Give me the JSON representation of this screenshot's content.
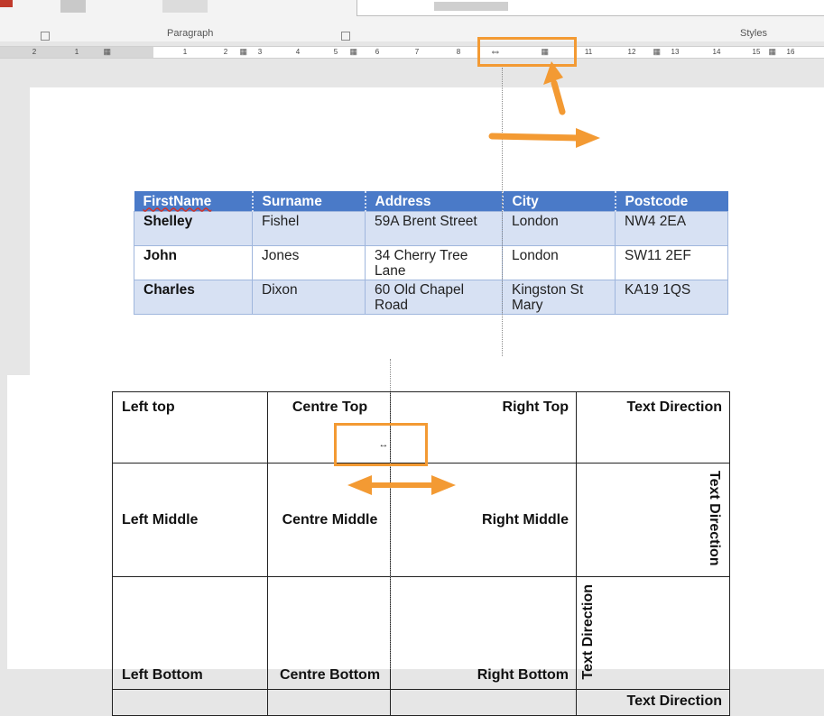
{
  "ribbon": {
    "groups": [
      {
        "label": "Paragraph"
      },
      {
        "label": "Styles"
      }
    ]
  },
  "ruler": {
    "left_numbers": [
      "2",
      "1"
    ],
    "numbers": [
      "1",
      "2",
      "3",
      "4",
      "5",
      "6",
      "7",
      "8",
      "11",
      "12",
      "13",
      "14",
      "15",
      "16"
    ],
    "drag_icon": "resize-horizontal-icon"
  },
  "table1": {
    "headers": [
      "FirstName",
      "Surname",
      "Address",
      "City",
      "Postcode"
    ],
    "rows": [
      [
        "Shelley",
        "Fishel",
        "59A Brent Street",
        "London",
        "NW4 2EA"
      ],
      [
        "John",
        "Jones",
        "34 Cherry Tree Lane",
        "London",
        "SW11 2EF"
      ],
      [
        "Charles",
        "Dixon",
        "60 Old Chapel Road",
        "Kingston St Mary",
        "KA19 1QS"
      ]
    ],
    "header_color": "#4a7ac8",
    "band_color": "#d7e1f3"
  },
  "table2": {
    "row1": [
      "Left top",
      "Centre Top",
      "Right Top",
      "Text Direction"
    ],
    "row2": [
      "Left Middle",
      "Centre Middle",
      "Right Middle",
      "Text Direction"
    ],
    "row3": [
      "Left Bottom",
      "Centre Bottom",
      "Right Bottom",
      "Text Direction"
    ],
    "row4": [
      "Text Direction"
    ]
  },
  "annotations": {
    "highlight_color": "#f39a33",
    "cell_cursor_icon": "column-resize-icon"
  }
}
